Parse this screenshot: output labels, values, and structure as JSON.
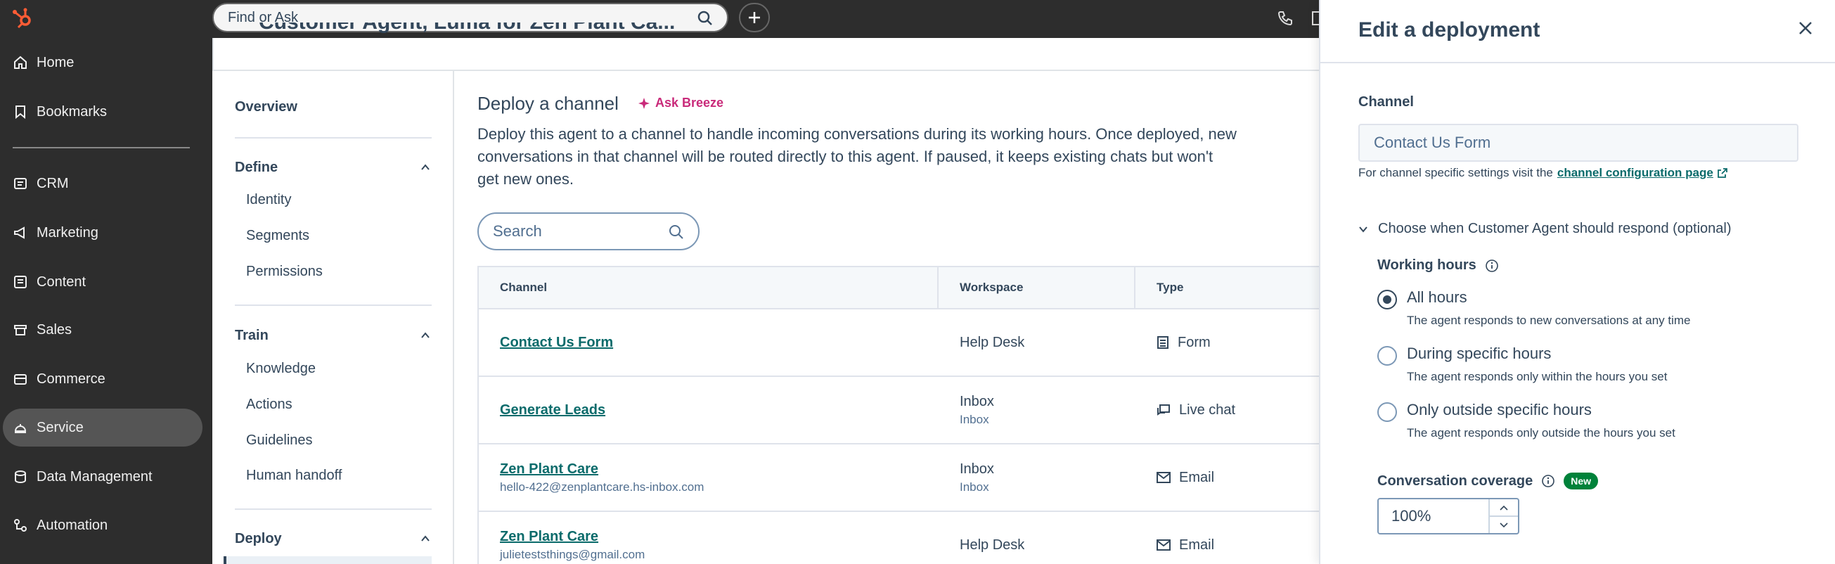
{
  "nav": {
    "items": [
      {
        "label": "Home",
        "icon": "home-icon"
      },
      {
        "label": "Bookmarks",
        "icon": "bookmark-icon"
      },
      {
        "label": "CRM",
        "icon": "crm-icon"
      },
      {
        "label": "Marketing",
        "icon": "megaphone-icon"
      },
      {
        "label": "Content",
        "icon": "content-icon"
      },
      {
        "label": "Sales",
        "icon": "sales-icon"
      },
      {
        "label": "Commerce",
        "icon": "commerce-icon"
      },
      {
        "label": "Service",
        "icon": "service-icon"
      },
      {
        "label": "Data Management",
        "icon": "database-icon"
      },
      {
        "label": "Automation",
        "icon": "automation-icon"
      }
    ],
    "active": "Service"
  },
  "topbar": {
    "search_placeholder": "Find or Ask"
  },
  "page": {
    "title_partial": "Customer Agent, Luma for Zen Plant Ca..."
  },
  "subnav": {
    "overview": "Overview",
    "define": {
      "label": "Define",
      "items": [
        "Identity",
        "Segments",
        "Permissions"
      ]
    },
    "train": {
      "label": "Train",
      "items": [
        "Knowledge",
        "Actions",
        "Guidelines",
        "Human handoff"
      ]
    },
    "deploy": {
      "label": "Deploy"
    }
  },
  "main": {
    "heading": "Deploy a channel",
    "ask_breeze": "Ask Breeze",
    "description": "Deploy this agent to a channel to handle incoming conversations during its working hours. Once deployed, new conversations in that channel will be routed directly to this agent. If paused, it keeps existing chats but won't get new ones.",
    "search_placeholder": "Search",
    "table": {
      "headers": [
        "Channel",
        "Workspace",
        "Type"
      ],
      "rows": [
        {
          "channel": "Contact Us Form",
          "channel_sub": "",
          "workspace": "Help Desk",
          "workspace_sub": "",
          "type": "Form",
          "type_icon": "form-icon"
        },
        {
          "channel": "Generate Leads",
          "channel_sub": "",
          "workspace": "Inbox",
          "workspace_sub": "Inbox",
          "type": "Live chat",
          "type_icon": "chat-icon"
        },
        {
          "channel": "Zen Plant Care",
          "channel_sub": "hello-422@zenplantcare.hs-inbox.com",
          "workspace": "Inbox",
          "workspace_sub": "Inbox",
          "type": "Email",
          "type_icon": "email-icon"
        },
        {
          "channel": "Zen Plant Care",
          "channel_sub": "julieteststhings@gmail.com",
          "workspace": "Help Desk",
          "workspace_sub": "",
          "type": "Email",
          "type_icon": "email-icon"
        }
      ]
    }
  },
  "panel": {
    "title": "Edit a deployment",
    "channel_label": "Channel",
    "channel_value": "Contact Us Form",
    "help_prefix": "For channel specific settings visit the",
    "help_link": "channel configuration page",
    "expander": "Choose when Customer Agent should respond (optional)",
    "working_hours_label": "Working hours",
    "options": [
      {
        "label": "All hours",
        "desc": "The agent responds to new conversations at any time",
        "selected": true
      },
      {
        "label": "During specific hours",
        "desc": "The agent responds only within the hours you set",
        "selected": false
      },
      {
        "label": "Only outside specific hours",
        "desc": "The agent responds only outside the hours you set",
        "selected": false
      }
    ],
    "coverage_label": "Conversation coverage",
    "coverage_badge": "New",
    "coverage_value": "100%"
  }
}
